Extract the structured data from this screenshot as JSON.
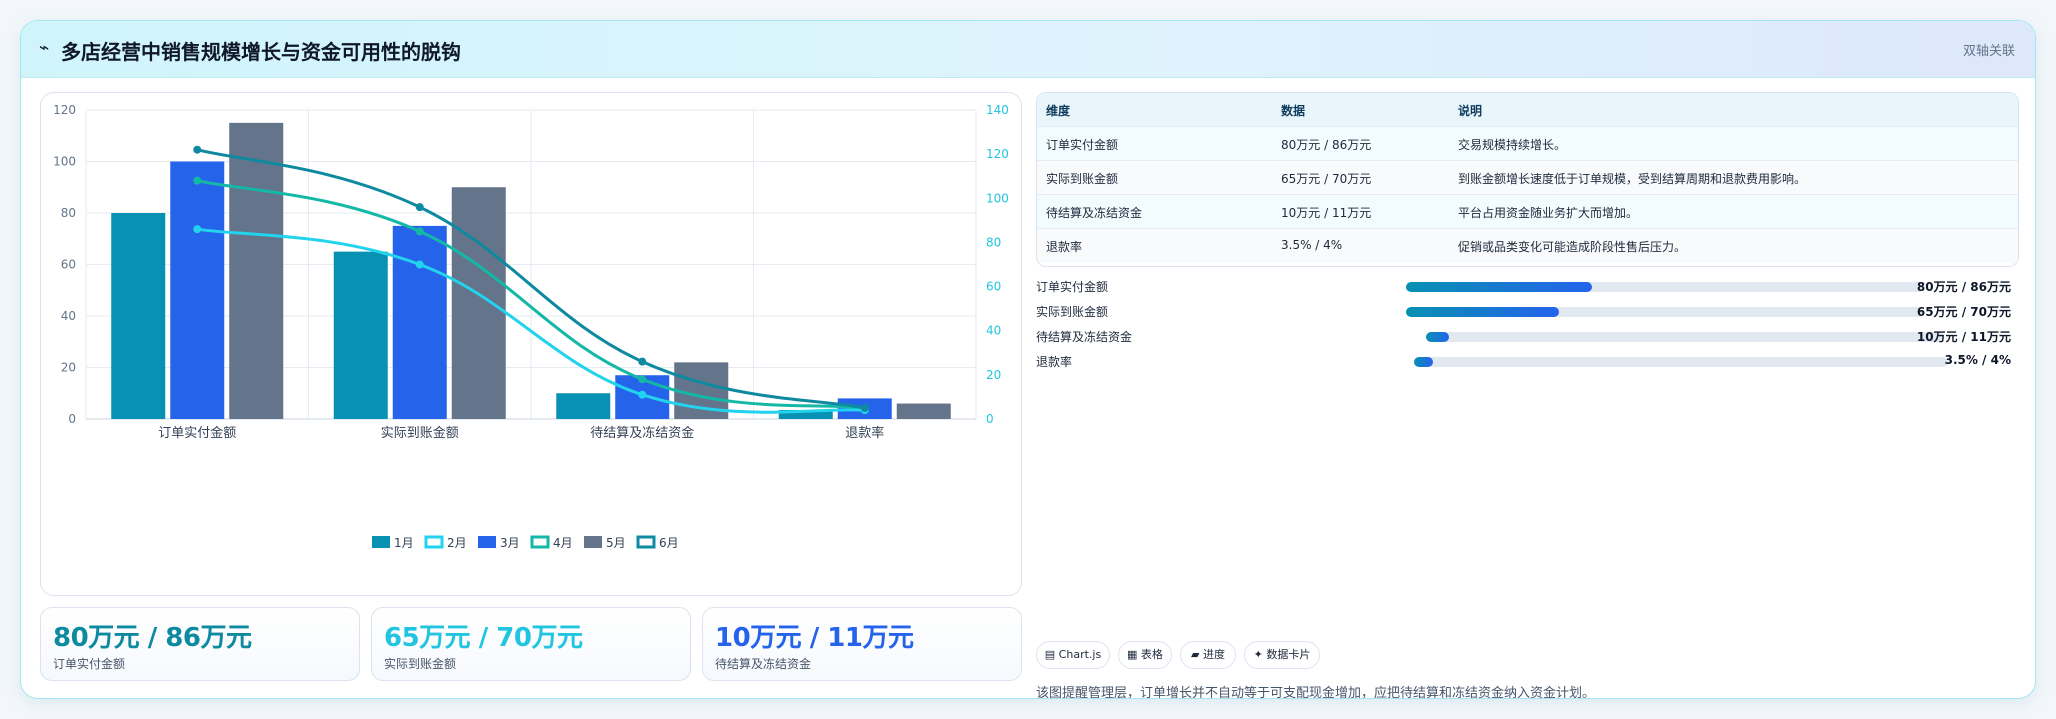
{
  "header": {
    "icon": "trend-icon",
    "title": "多店经营中销售规模增长与资金可用性的脱钩",
    "badge": "双轴关联"
  },
  "chart_data": {
    "type": "bar",
    "categories": [
      "订单实付金额",
      "实际到账金额",
      "待结算及冻结资金",
      "退款率"
    ],
    "series": [
      {
        "name": "1月",
        "type": "bar",
        "axis": "left",
        "color": "#0891b2",
        "values": [
          80,
          65,
          10,
          3.5
        ]
      },
      {
        "name": "2月",
        "type": "line",
        "axis": "right",
        "color": "#22d3ee",
        "values": [
          86,
          70,
          11,
          4
        ]
      },
      {
        "name": "3月",
        "type": "bar",
        "axis": "left",
        "color": "#2563eb",
        "values": [
          100,
          75,
          17,
          8
        ]
      },
      {
        "name": "4月",
        "type": "line",
        "axis": "right",
        "color": "#14b8a6",
        "values": [
          108,
          85,
          18,
          5
        ]
      },
      {
        "name": "5月",
        "type": "bar",
        "axis": "left",
        "color": "#64748b",
        "values": [
          115,
          90,
          22,
          6
        ]
      },
      {
        "name": "6月",
        "type": "line",
        "axis": "right",
        "color": "#0e8aa0",
        "values": [
          122,
          96,
          26,
          5
        ]
      }
    ],
    "y_left": {
      "min": 0,
      "max": 120,
      "ticks": [
        0,
        20,
        40,
        60,
        80,
        100,
        120
      ]
    },
    "y_right": {
      "min": 0,
      "max": 140,
      "ticks": [
        0,
        20,
        40,
        60,
        80,
        100,
        120,
        140
      ]
    },
    "grid": true,
    "legend": "bottom-center"
  },
  "kpis": [
    {
      "value": "80万元 / 86万元",
      "label": "订单实付金额",
      "color": "#0e8aa0"
    },
    {
      "value": "65万元 / 70万元",
      "label": "实际到账金额",
      "color": "#22c5e0"
    },
    {
      "value": "10万元 / 11万元",
      "label": "待结算及冻结资金",
      "color": "#2563eb"
    }
  ],
  "table": {
    "headers": [
      "维度",
      "数据",
      "说明"
    ],
    "rows": [
      [
        "订单实付金额",
        "80万元 / 86万元",
        "交易规模持续增长。"
      ],
      [
        "实际到账金额",
        "65万元 / 70万元",
        "到账金额增长速度低于订单规模，受到结算周期和退款费用影响。"
      ],
      [
        "待结算及冻结资金",
        "10万元 / 11万元",
        "平台占用资金随业务扩大而增加。"
      ],
      [
        "退款率",
        "3.5% / 4%",
        "促销或品类变化可能造成阶段性售后压力。"
      ]
    ]
  },
  "progress": [
    {
      "label": "订单实付金额",
      "value": "80万元 / 86万元",
      "fraction": 0.36
    },
    {
      "label": "实际到账金额",
      "value": "65万元 / 70万元",
      "fraction": 0.295
    },
    {
      "label": "待结算及冻结资金",
      "value": "10万元 / 11万元",
      "fraction": 0.045
    },
    {
      "label": "退款率",
      "value": "3.5% / 4%",
      "fraction": 0.035
    }
  ],
  "pills": [
    {
      "icon": "chart-icon",
      "label": "▤ Chart.js"
    },
    {
      "icon": "table-icon",
      "label": "▦ 表格"
    },
    {
      "icon": "progress-icon",
      "label": "▰ 进度"
    },
    {
      "icon": "card-icon",
      "label": "✦ 数据卡片"
    }
  ],
  "note": "该图提醒管理层，订单增长并不自动等于可支配现金增加，应把待结算和冻结资金纳入资金计划。"
}
